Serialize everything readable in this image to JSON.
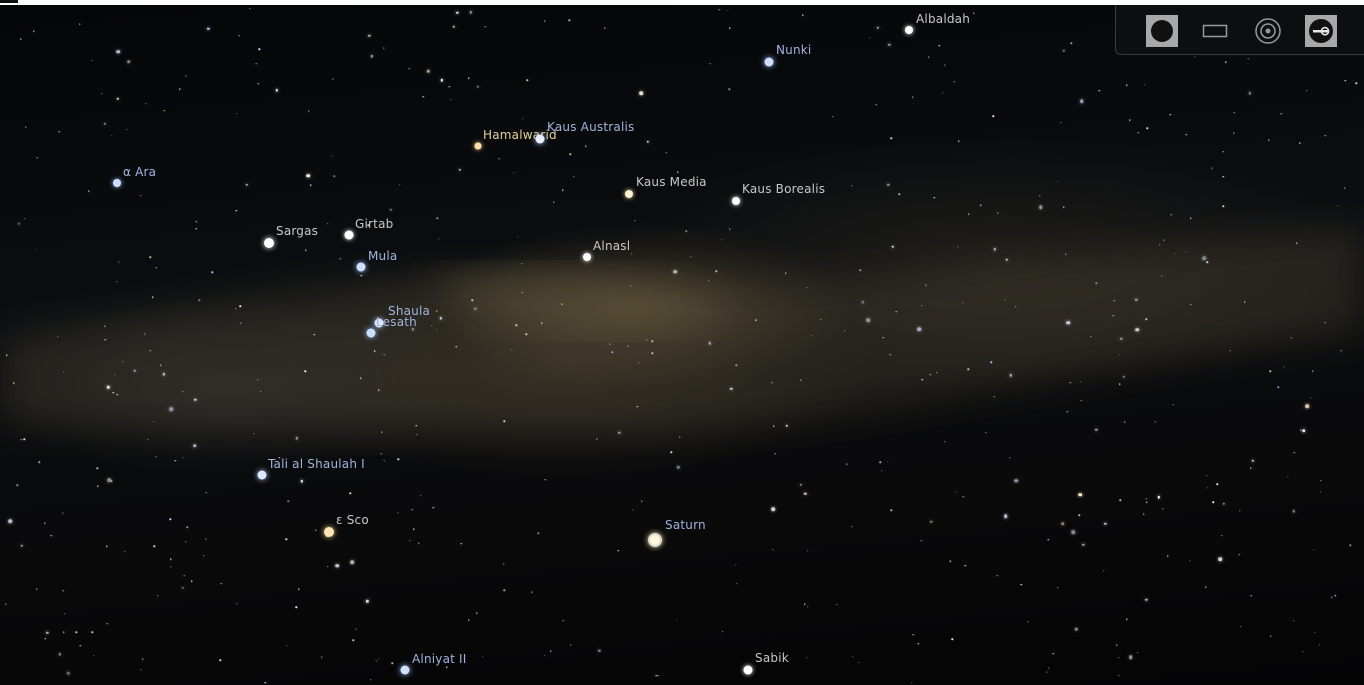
{
  "toolbar": {
    "buttons": [
      {
        "name": "ground-toggle-button",
        "icon": "ground-disc-icon",
        "active": true
      },
      {
        "name": "constellation-art-button",
        "icon": "rectangle-frame-icon",
        "active": false
      },
      {
        "name": "night-vision-button",
        "icon": "target-circle-icon",
        "active": false
      },
      {
        "name": "pan-tool-button",
        "icon": "wrench-key-icon",
        "active": true
      }
    ]
  },
  "colors": {
    "label_blue": "#9fb4dc",
    "label_gray": "#c8c8c8",
    "label_gold": "#e7cf9a",
    "toolbar_active": "#a8a8a8"
  },
  "sky": {
    "labels": {
      "albaldah": "Albaldah",
      "nunki": "Nunki",
      "hamalwarid": "Hamalwarid",
      "kaus_australis": "Kaus Australis",
      "alpha_ara": "α Ara",
      "kaus_media": "Kaus Media",
      "kaus_borealis": "Kaus Borealis",
      "sargas": "Sargas",
      "girtab": "Girtab",
      "alnasl": "Alnasl",
      "mula": "Mula",
      "shaula": "Shaula",
      "lesath": "Lesath",
      "tali_al_shaulah": "Tali al Shaulah I",
      "epsilon_sco": "ε Sco",
      "saturn": "Saturn",
      "alniyat": "Alniyat II",
      "sabik": "Sabik"
    }
  }
}
